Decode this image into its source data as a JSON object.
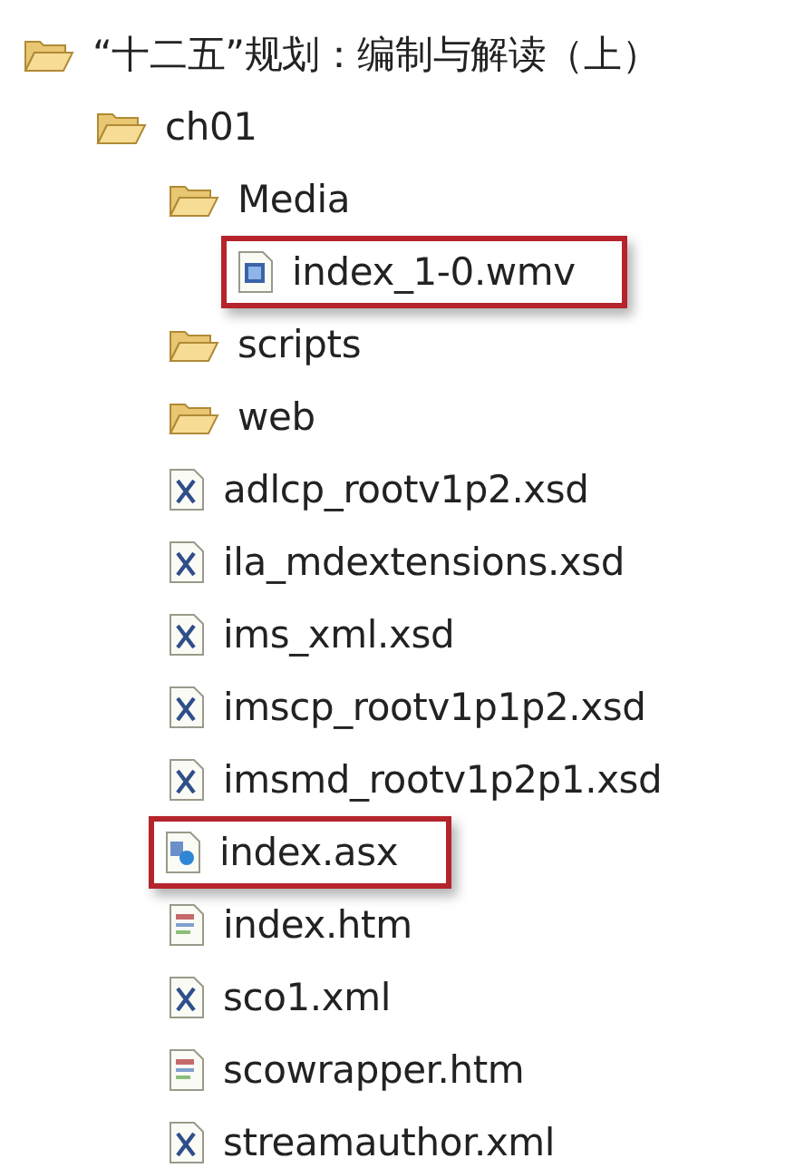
{
  "tree": [
    {
      "kind": "folder",
      "label": "“十二五”规划：编制与解读（上）",
      "highlighted": false,
      "children": [
        {
          "kind": "folder",
          "label": "ch01",
          "highlighted": false,
          "children": [
            {
              "kind": "folder",
              "label": "Media",
              "highlighted": false,
              "children": [
                {
                  "kind": "video",
                  "label": "index_1-0.wmv",
                  "highlighted": true
                }
              ]
            },
            {
              "kind": "folder",
              "label": "scripts",
              "highlighted": false
            },
            {
              "kind": "folder",
              "label": "web",
              "highlighted": false
            },
            {
              "kind": "xml",
              "label": "adlcp_rootv1p2.xsd",
              "highlighted": false
            },
            {
              "kind": "xml",
              "label": "ila_mdextensions.xsd",
              "highlighted": false
            },
            {
              "kind": "xml",
              "label": "ims_xml.xsd",
              "highlighted": false
            },
            {
              "kind": "xml",
              "label": "imscp_rootv1p1p2.xsd",
              "highlighted": false
            },
            {
              "kind": "xml",
              "label": "imsmd_rootv1p2p1.xsd",
              "highlighted": false
            },
            {
              "kind": "playlist",
              "label": "index.asx",
              "highlighted": true
            },
            {
              "kind": "html",
              "label": "index.htm",
              "highlighted": false
            },
            {
              "kind": "xml",
              "label": "sco1.xml",
              "highlighted": false
            },
            {
              "kind": "html",
              "label": "scowrapper.htm",
              "highlighted": false
            },
            {
              "kind": "xml",
              "label": "streamauthor.xml",
              "highlighted": false
            }
          ]
        }
      ]
    }
  ]
}
